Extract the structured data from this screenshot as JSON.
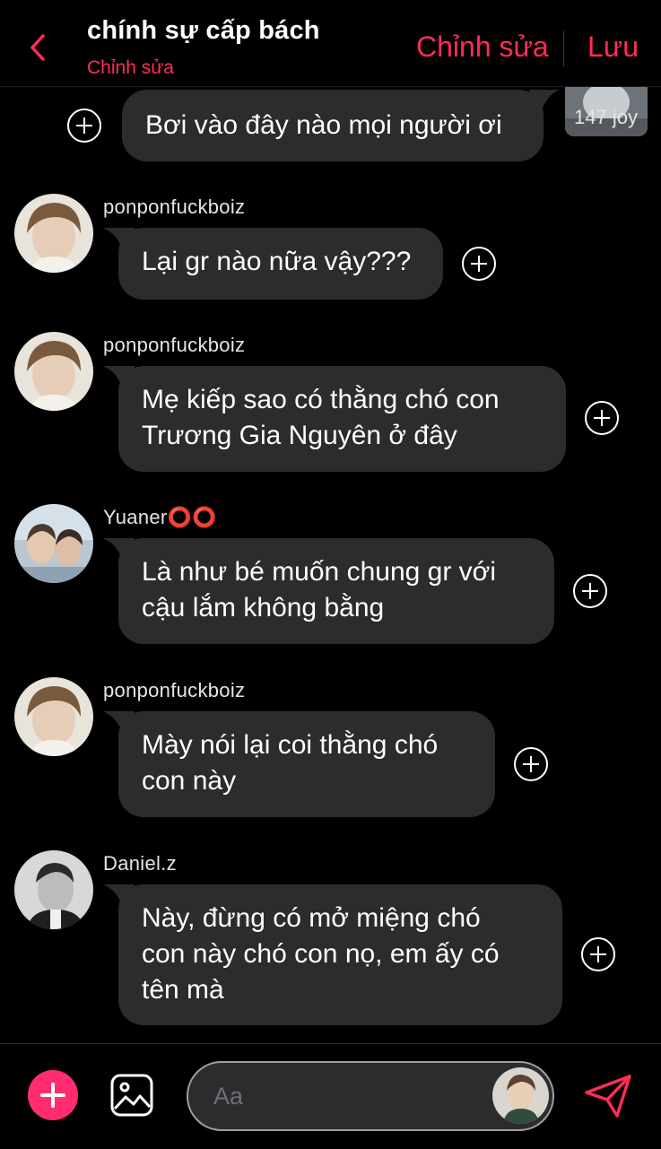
{
  "header": {
    "title": "chính sự cấp bách",
    "subtitle": "Chỉnh sửa",
    "edit_label": "Chỉnh sửa",
    "save_label": "Lưu"
  },
  "top_message": {
    "text": "Bơi vào đây nào mọi người ơi",
    "thumbnail_count": "147 joy"
  },
  "messages": [
    {
      "sender": "ponponfuckboiz",
      "lines": [
        "Lại gr nào nữa vậy???"
      ]
    },
    {
      "sender": "ponponfuckboiz",
      "lines": [
        "Mẹ kiếp sao có thằng chó con",
        "Trương Gia Nguyên ở đây"
      ]
    },
    {
      "sender": "Yuaner⭕⭕",
      "lines": [
        "Là như bé muốn chung gr với",
        "cậu lắm không bằng"
      ]
    },
    {
      "sender": "ponponfuckboiz",
      "lines": [
        "Mày nói lại coi thằng chó",
        "con này"
      ]
    },
    {
      "sender": "Daniel.z",
      "lines": [
        "Này, đừng có mở miệng chó",
        "con này chó con nọ, em ấy có",
        "tên mà"
      ]
    }
  ],
  "composer": {
    "placeholder": "Aa"
  },
  "colors": {
    "accent": "#ff2d55",
    "bubble": "#2c2c2e",
    "background": "#000000"
  }
}
